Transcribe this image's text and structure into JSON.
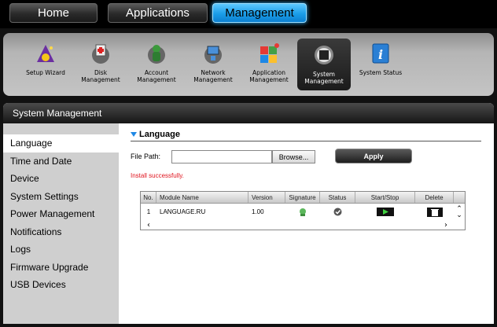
{
  "top_tabs": [
    {
      "label": "Home",
      "active": false
    },
    {
      "label": "Applications",
      "active": false
    },
    {
      "label": "Management",
      "active": true
    }
  ],
  "toolbar": [
    {
      "label": "Setup Wizard",
      "icon": "wizard-icon",
      "active": false
    },
    {
      "label": "Disk\nManagement",
      "icon": "disk-gear-icon",
      "active": false
    },
    {
      "label": "Account\nManagement",
      "icon": "account-gear-icon",
      "active": false
    },
    {
      "label": "Network\nManagement",
      "icon": "network-gear-icon",
      "active": false
    },
    {
      "label": "Application\nManagement",
      "icon": "application-blocks-icon",
      "active": false
    },
    {
      "label": "System\nManagement",
      "icon": "system-gear-icon",
      "active": true
    },
    {
      "label": "System Status",
      "icon": "info-icon",
      "active": false
    }
  ],
  "panel": {
    "title": "System Management",
    "sidebar": [
      {
        "label": "Language",
        "active": true
      },
      {
        "label": "Time and Date",
        "active": false
      },
      {
        "label": "Device",
        "active": false
      },
      {
        "label": "System Settings",
        "active": false
      },
      {
        "label": "Power Management",
        "active": false
      },
      {
        "label": "Notifications",
        "active": false
      },
      {
        "label": "Logs",
        "active": false
      },
      {
        "label": "Firmware Upgrade",
        "active": false
      },
      {
        "label": "USB Devices",
        "active": false
      }
    ],
    "section_title": "Language",
    "file_path_label": "File Path:",
    "file_path_value": "",
    "browse_label": "Browse...",
    "apply_label": "Apply",
    "status_message": "Install successfully.",
    "table": {
      "headers": [
        "No.",
        "Module Name",
        "Version",
        "Signature",
        "Status",
        "Start/Stop",
        "Delete"
      ],
      "rows": [
        {
          "no": "1",
          "module": "LANGUAGE.RU",
          "version": "1.00"
        }
      ]
    }
  },
  "colors": {
    "active_tab": "#1a9de8",
    "status_message": "#e0141e",
    "accent_triangle": "#1e88e5"
  }
}
